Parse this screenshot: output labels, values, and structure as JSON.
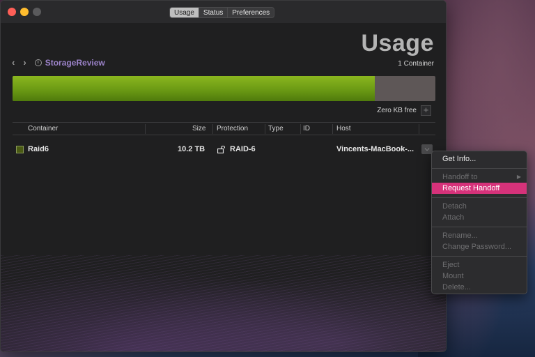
{
  "window": {
    "tabs": [
      {
        "label": "Usage",
        "active": true
      },
      {
        "label": "Status",
        "active": false
      },
      {
        "label": "Preferences",
        "active": false
      }
    ]
  },
  "header": {
    "title": "Usage",
    "breadcrumb": "StorageReview",
    "container_count": "1 Container"
  },
  "usage": {
    "used_fraction": 0.857,
    "free_label": "Zero KB free",
    "used_color": "#7aa81a",
    "free_color": "#5e5757"
  },
  "table": {
    "columns": [
      "Container",
      "Size",
      "Protection",
      "Type",
      "ID",
      "Host"
    ],
    "rows": [
      {
        "container": "Raid6",
        "size": "10.2 TB",
        "protection": "RAID-6",
        "type": "",
        "id": "",
        "host": "Vincents-MacBook-..."
      }
    ]
  },
  "context_menu": {
    "items": [
      {
        "label": "Get Info...",
        "enabled": true
      },
      {
        "label": "Handoff to",
        "enabled": false,
        "submenu": true
      },
      {
        "label": "Request Handoff",
        "enabled": true,
        "highlighted": true
      },
      {
        "label": "Detach",
        "enabled": false
      },
      {
        "label": "Attach",
        "enabled": false
      },
      {
        "label": "Rename...",
        "enabled": false
      },
      {
        "label": "Change Password...",
        "enabled": false
      },
      {
        "label": "Eject",
        "enabled": false
      },
      {
        "label": "Mount",
        "enabled": false
      },
      {
        "label": "Delete...",
        "enabled": false
      }
    ],
    "highlight_color": "#d6327a"
  },
  "icons": {
    "back": "chevron-left-icon",
    "forward": "chevron-right-icon",
    "info": "info-icon",
    "lock": "unlock-icon",
    "add": "plus-icon",
    "row_menu": "chevron-down-icon",
    "submenu": "triangle-right-icon"
  }
}
